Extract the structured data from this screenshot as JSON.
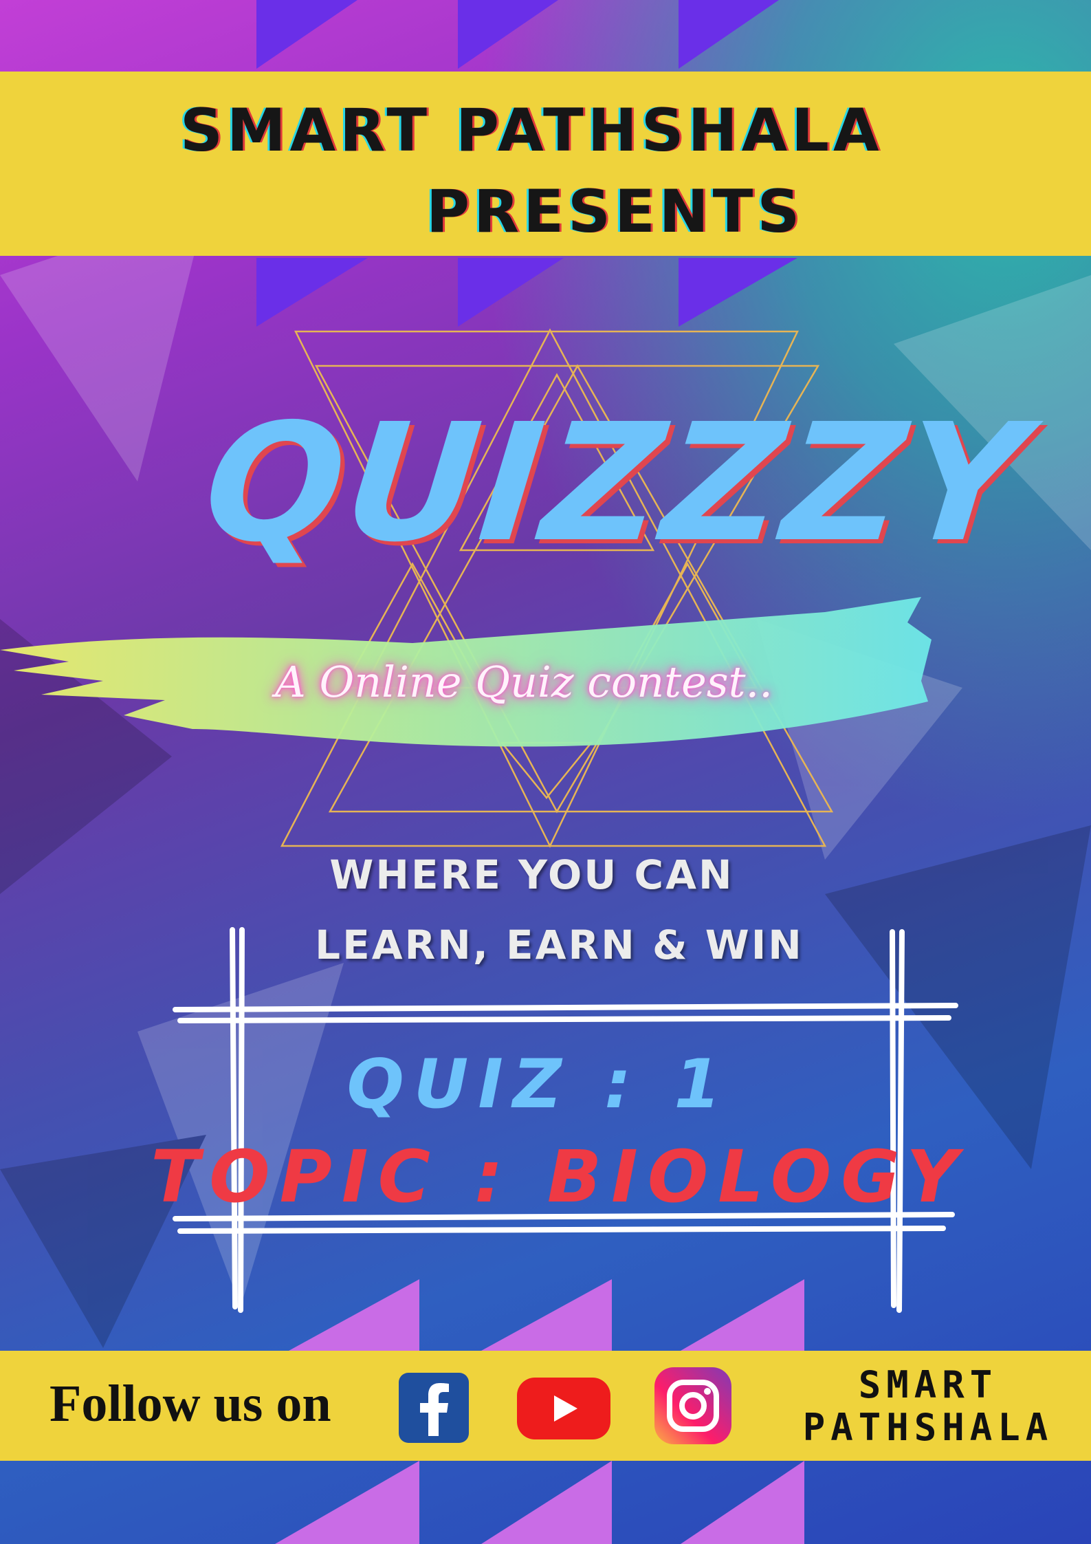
{
  "header": {
    "line1": "SMART PATHSHALA",
    "line2": "PRESENTS"
  },
  "title": "QUIZZZY",
  "subtitle": "A Online Quiz contest..",
  "tagline": {
    "line1": "WHERE YOU CAN",
    "line2": "LEARN, EARN & WIN"
  },
  "quiz": {
    "number_label": "QUIZ : 1",
    "topic_label": "TOPIC : BIOLOGY"
  },
  "footer": {
    "follow_label": "Follow us on",
    "brand_line1": "SMART",
    "brand_line2": "PATHSHALA",
    "social_icons": [
      "facebook-icon",
      "youtube-icon",
      "instagram-icon"
    ]
  },
  "colors": {
    "band_yellow": "#efd33c",
    "title_blue": "#6ec3fb",
    "topic_red": "#ef3a44",
    "facebook": "#1f4f9e",
    "youtube": "#ee1c1c"
  }
}
